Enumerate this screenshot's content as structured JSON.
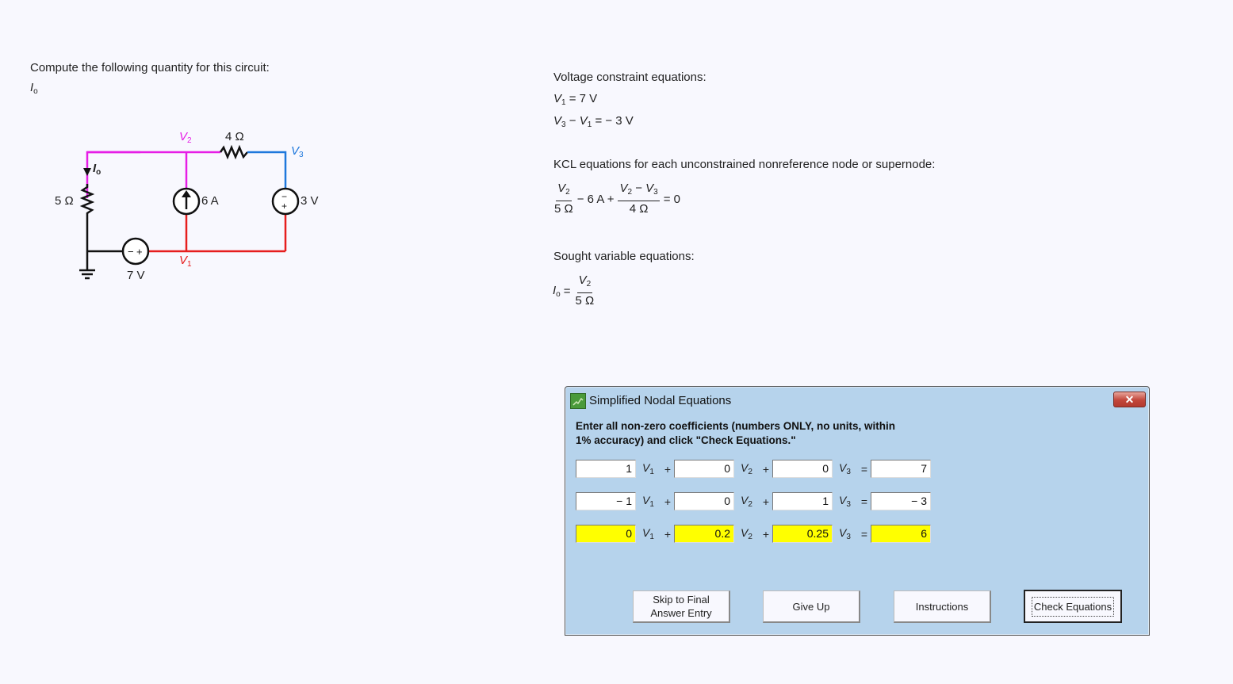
{
  "problem": {
    "prompt": "Compute the following quantity for this circuit:",
    "quantity_main": "I",
    "quantity_sub": "o"
  },
  "circuit": {
    "labels": {
      "v2": "V",
      "v2_sub": "2",
      "v3": "V",
      "v3_sub": "3",
      "v1": "V",
      "v1_sub": "1",
      "io": "I",
      "io_sub": "o",
      "r5": "5 Ω",
      "r4": "4 Ω",
      "current_source": "6 A",
      "vsource_3": "3 V",
      "vsource_7": "7 V"
    },
    "colors": {
      "v2_wire": "#e61ee6",
      "v3_wire": "#1e78dc",
      "v1_wire": "#e61e1e",
      "ground_wire": "#111111"
    }
  },
  "equations": {
    "voltage_header": "Voltage constraint equations:",
    "vc1": "= 7 V",
    "vc2_mid": "−",
    "vc2_rhs": "= − 3 V",
    "kcl_header": "KCL equations for each unconstrained nonreference node or supernode:",
    "kcl_den1": "5 Ω",
    "kcl_mid": "− 6 A +",
    "kcl_num2_mid": "−",
    "kcl_den2": "4 Ω",
    "kcl_rhs": "= 0",
    "sought_header": "Sought variable equations:",
    "sought_eq": "=",
    "sought_den": "5 Ω"
  },
  "dialog": {
    "title": "Simplified Nodal Equations",
    "close_label": "✕",
    "instructions_line1": "Enter all non-zero coefficients (numbers ONLY, no units, within",
    "instructions_line2": "1% accuracy) and click \"Check Equations.\"",
    "rows": [
      {
        "c1": "1",
        "c2": "0",
        "c3": "0",
        "rhs": "7",
        "highlight": false
      },
      {
        "c1": "− 1",
        "c2": "0",
        "c3": "1",
        "rhs": "− 3",
        "highlight": false
      },
      {
        "c1": "0",
        "c2": "0.2",
        "c3": "0.25",
        "rhs": "6",
        "highlight": true
      }
    ],
    "var_v": "V",
    "plus": "+",
    "equals": "=",
    "buttons": {
      "skip_line1": "Skip to Final",
      "skip_line2": "Answer Entry",
      "give_up": "Give Up",
      "instructions": "Instructions",
      "check": "Check Equations"
    },
    "highlight_color": "#ffff00"
  }
}
